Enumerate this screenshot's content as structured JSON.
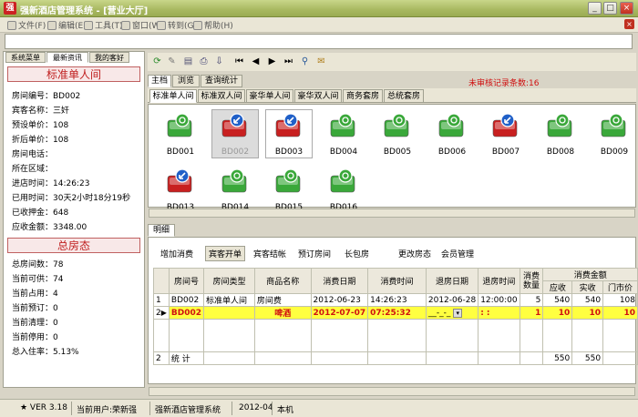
{
  "window": {
    "title": "强新酒店管理系统 - [营业大厅]"
  },
  "menu": {
    "items": [
      "文件(F)",
      "编辑(E)",
      "工具(T)",
      "窗口(W)",
      "转到(G)",
      "帮助(H)"
    ]
  },
  "left_panel": {
    "tabs": [
      "系统菜单",
      "最新资讯",
      "我的客好"
    ],
    "active_tab": "最新资讯",
    "room_section_title": "标准单人间",
    "room_info": [
      "房间编号：BD002",
      "宾客名称：三奸",
      "预设单价：108",
      "折后单价：108",
      "房间电话：",
      "所在区域：",
      "进店时间：14:26:23",
      "已用时间：30天2小时18分19秒",
      "已收押金：648",
      "应收金额：3348.00"
    ],
    "status_section_title": "总房态",
    "status_info": [
      "总房间数：78",
      "当前可供：74",
      "当前占用：4",
      "当前预订：0",
      "当前清理：0",
      "当前停用：0",
      "总入住率：5.13%"
    ]
  },
  "main_tabs": [
    "主档",
    "浏览",
    "查询统计"
  ],
  "active_main_tab": "主档",
  "unreviewed_label": "未审核记录条数:16",
  "room_tabs": [
    "标准单人间",
    "标准双人间",
    "豪华单人间",
    "豪华双人间",
    "商务套房",
    "总统套房"
  ],
  "active_room_tab": "标准单人间",
  "rooms": [
    {
      "id": "BD001",
      "status": "vacant"
    },
    {
      "id": "BD002",
      "status": "occupied"
    },
    {
      "id": "BD003",
      "status": "occupied"
    },
    {
      "id": "BD004",
      "status": "vacant"
    },
    {
      "id": "BD005",
      "status": "vacant"
    },
    {
      "id": "BD006",
      "status": "vacant"
    },
    {
      "id": "BD007",
      "status": "occupied"
    },
    {
      "id": "BD008",
      "status": "vacant"
    },
    {
      "id": "BD009",
      "status": "vacant"
    },
    {
      "id": "BD013",
      "status": "occupied"
    },
    {
      "id": "BD014",
      "status": "vacant"
    },
    {
      "id": "BD015",
      "status": "vacant"
    },
    {
      "id": "BD016",
      "status": "vacant"
    }
  ],
  "detail": {
    "tab_label": "明细",
    "buttons": [
      "增加消费",
      "宾客开单",
      "宾客结帐",
      "预订房间",
      "长包房",
      "更改房态",
      "会员管理"
    ],
    "active_button": "宾客开单",
    "table": {
      "headers": [
        "房间号",
        "房间类型",
        "商品名称",
        "消费日期",
        "消费时间",
        "退房日期",
        "退房时间",
        "消费数量"
      ],
      "amount_group": "消费金额",
      "amount_headers": [
        "应收",
        "实收",
        "门市价"
      ],
      "rows": [
        {
          "no": "1",
          "room": "BD002",
          "type": "标准单人间",
          "item": "房间费",
          "date": "2012-06-23",
          "time": "14:26:23",
          "out_date": "2012-06-28",
          "out_time": "12:00:00",
          "qty": "5",
          "due": "540",
          "paid": "540",
          "rack": "108"
        },
        {
          "no": "2",
          "room": "BD002",
          "type": "",
          "item": "啤酒",
          "date": "2012-07-07",
          "time": "07:25:32",
          "out_date": "__-_-_",
          "out_time": ": :",
          "qty": "1",
          "due": "10",
          "paid": "10",
          "rack": "10"
        }
      ],
      "summary": {
        "no": "2",
        "label": "统 计",
        "due": "550",
        "paid": "550"
      }
    }
  },
  "statusbar": {
    "version": "★ VER 3.18",
    "user": "当前用户:荣新强",
    "system": "强新酒店管理系统",
    "date": "2012-04",
    "location": "本机"
  },
  "colors": {
    "title_bar": "#a8b860",
    "section_title": "#c02020",
    "highlight_row": "#ffff40",
    "alert_text": "#d01010"
  }
}
